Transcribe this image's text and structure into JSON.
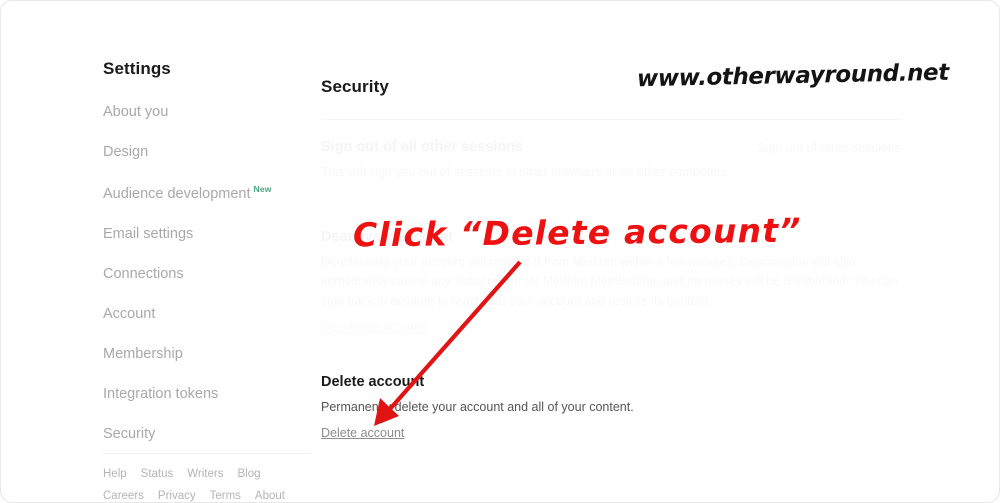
{
  "window": {
    "background": "#ffffff",
    "accent_red": "#ee1111"
  },
  "sidebar": {
    "title": "Settings",
    "items": [
      {
        "label": "About you",
        "badge": ""
      },
      {
        "label": "Design",
        "badge": ""
      },
      {
        "label": "Audience development",
        "badge": "New"
      },
      {
        "label": "Email settings",
        "badge": ""
      },
      {
        "label": "Connections",
        "badge": ""
      },
      {
        "label": "Account",
        "badge": ""
      },
      {
        "label": "Membership",
        "badge": ""
      },
      {
        "label": "Integration tokens",
        "badge": ""
      },
      {
        "label": "Security",
        "badge": ""
      }
    ],
    "badge_color": "#4aa981",
    "footer": {
      "row1": [
        "Help",
        "Status",
        "Writers",
        "Blog"
      ],
      "row2": [
        "Careers",
        "Privacy",
        "Terms",
        "About"
      ]
    }
  },
  "main": {
    "title": "Security",
    "sections": {
      "sessions": {
        "heading": "Sign out of all other sessions",
        "body": "This will sign you out of sessions in other browsers or on other computers.",
        "action": "Sign out of other sessions"
      },
      "deactivate": {
        "heading": "Deactivate account",
        "body": "Deactivating your account will remove it from Medium within a few minutes. Deactivation will also immediately cancel any subscription for Medium Membership and no money will be reimbursed. You can sign back in anytime to reactivate your account and restore its content.",
        "link": "Deactivate account"
      },
      "delete": {
        "heading": "Delete account",
        "body": "Permanently delete your account and all of your content.",
        "link": "Delete account"
      }
    }
  },
  "annotations": {
    "watermark": "www.otherwayround.net",
    "instruction": "Click “Delete account”",
    "arrow_color": "#e11414"
  }
}
